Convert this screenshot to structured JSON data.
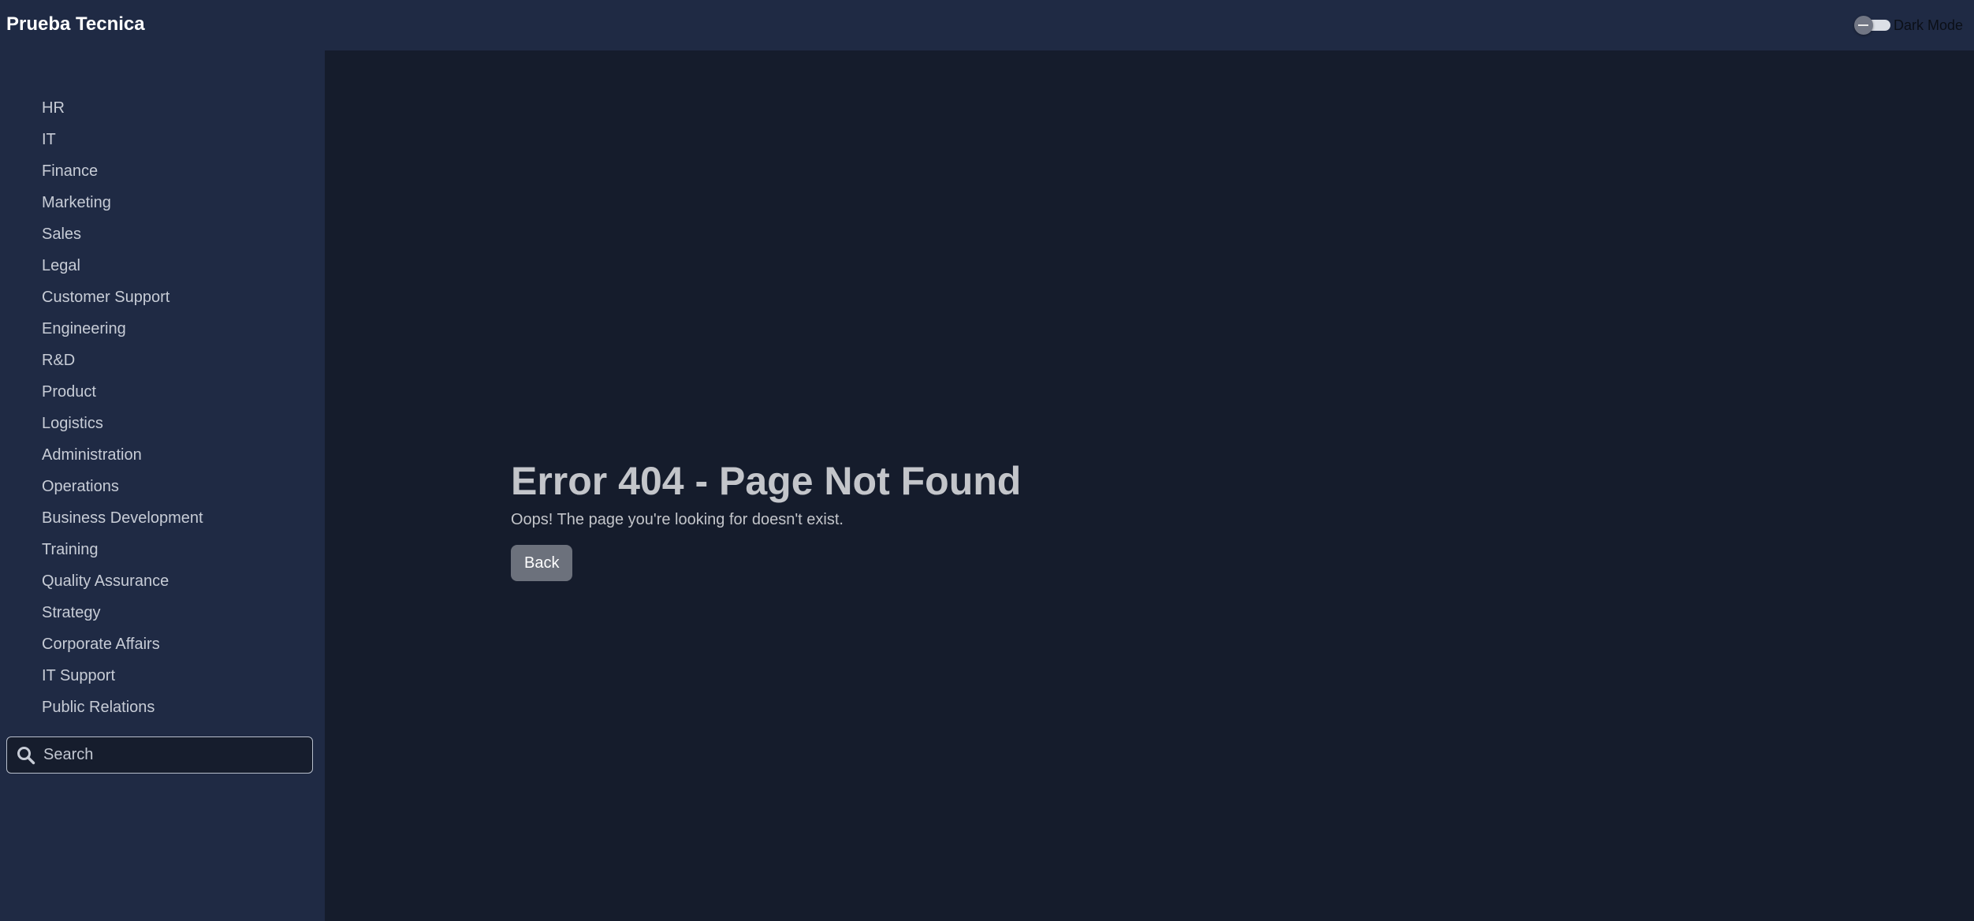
{
  "header": {
    "title": "Prueba Tecnica",
    "dark_mode_label": "Dark Mode"
  },
  "sidebar": {
    "items": [
      {
        "label": "HR"
      },
      {
        "label": "IT"
      },
      {
        "label": "Finance"
      },
      {
        "label": "Marketing"
      },
      {
        "label": "Sales"
      },
      {
        "label": "Legal"
      },
      {
        "label": "Customer Support"
      },
      {
        "label": "Engineering"
      },
      {
        "label": "R&D"
      },
      {
        "label": "Product"
      },
      {
        "label": "Logistics"
      },
      {
        "label": "Administration"
      },
      {
        "label": "Operations"
      },
      {
        "label": "Business Development"
      },
      {
        "label": "Training"
      },
      {
        "label": "Quality Assurance"
      },
      {
        "label": "Strategy"
      },
      {
        "label": "Corporate Affairs"
      },
      {
        "label": "IT Support"
      },
      {
        "label": "Public Relations"
      }
    ],
    "search": {
      "placeholder": "Search",
      "value": "",
      "icon": "search-icon"
    }
  },
  "main": {
    "error_title": "Error 404 - Page Not Found",
    "error_message": "Oops! The page you're looking for doesn't exist.",
    "back_label": "Back"
  },
  "colors": {
    "header_bg": "#1f2a44",
    "sidebar_bg": "#1f2a44",
    "main_bg": "#151c2c",
    "button_bg": "#6c717c",
    "text_muted": "#c3c5ca"
  }
}
